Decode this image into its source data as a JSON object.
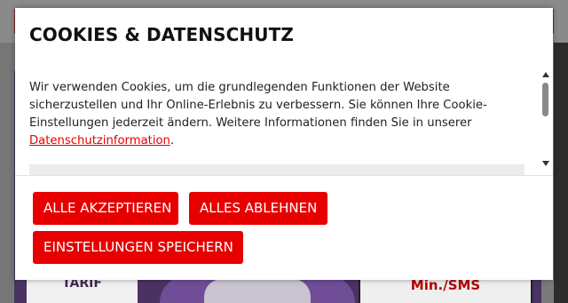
{
  "background": {
    "tarif_text": "TARIF",
    "phone_text": "Min./SMS"
  },
  "cookie_dialog": {
    "title": "COOKIES & DATENSCHUTZ",
    "body_text": "Wir verwenden Cookies, um die grundlegenden Funktionen der Website sicherzustellen und Ihr Online-Erlebnis zu verbessern. Sie können Ihre Cookie-Einstellungen jederzeit ändern. Weitere Informationen finden Sie in unserer ",
    "privacy_link": "Datenschutzinformation",
    "body_text_end": ".",
    "buttons": {
      "accept_all": "ALLE AKZEPTIEREN",
      "reject_all": "ALLES ABLEHNEN",
      "save_settings": "EINSTELLUNGEN SPEICHERN"
    }
  },
  "colors": {
    "accent": "#e60000",
    "overlay": "#7a7a7a",
    "banner": "#4a3362"
  }
}
